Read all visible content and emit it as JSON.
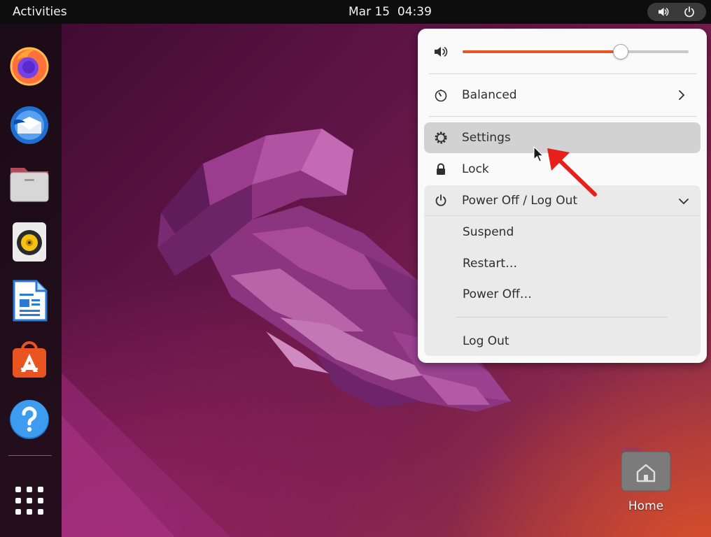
{
  "topbar": {
    "activities_label": "Activities",
    "clock": "Mar 15  04:39",
    "tray_icons": [
      "volume-icon",
      "power-icon"
    ]
  },
  "dock": {
    "apps": [
      {
        "name": "Firefox",
        "icon": "firefox-icon"
      },
      {
        "name": "Thunderbird",
        "icon": "thunderbird-icon"
      },
      {
        "name": "Files",
        "icon": "files-icon"
      },
      {
        "name": "Rhythmbox",
        "icon": "rhythmbox-icon"
      },
      {
        "name": "LibreOffice Writer",
        "icon": "writer-icon"
      },
      {
        "name": "Ubuntu Software",
        "icon": "software-icon"
      },
      {
        "name": "Help",
        "icon": "help-icon"
      }
    ],
    "show_apps_icon": "grid-icon"
  },
  "system_menu": {
    "volume": {
      "icon": "speaker-icon",
      "level": 0.7
    },
    "power_mode": {
      "label": "Balanced",
      "icon": "power-mode-icon"
    },
    "settings_label": "Settings",
    "lock_label": "Lock",
    "power_off": {
      "label": "Power Off / Log Out",
      "expanded": true,
      "items": [
        "Suspend",
        "Restart…",
        "Power Off…",
        "Log Out"
      ]
    },
    "highlighted_item": "Settings"
  },
  "desktop": {
    "icons": [
      {
        "label": "Home",
        "icon": "home-folder-icon"
      }
    ]
  },
  "colors": {
    "accent": "#e95420",
    "annotation_arrow": "#e8201a",
    "topbar": "#0d0d0d",
    "menu_background": "#fafafa"
  }
}
